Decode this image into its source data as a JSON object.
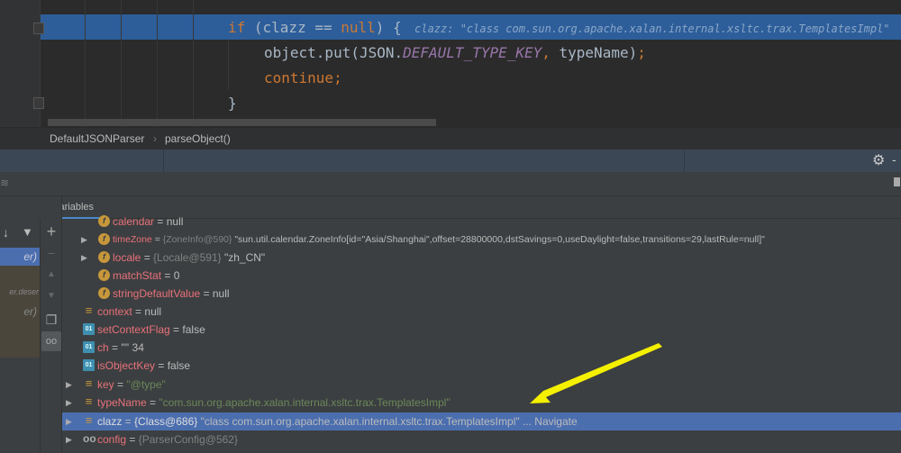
{
  "editor": {
    "line1": {
      "kw_if": "if",
      "open": " (clazz == ",
      "kw_null": "null",
      ") {": ") {",
      "hint": "  clazz: \"class com.sun.org.apache.xalan.internal.xsltc.trax.TemplatesImpl\""
    },
    "line2": {
      "pre": "object.put(JSON.",
      "const": "DEFAULT_TYPE_KEY",
      "comma": ",",
      "post": " typeName)",
      "semi": ";"
    },
    "line3": {
      "kw": "continue",
      "semi": ";"
    },
    "line4": "}"
  },
  "breadcrumb": {
    "items": [
      "DefaultJSONParser",
      "parseObject()"
    ],
    "sep": "›"
  },
  "debugger": {
    "tab": "Variables",
    "frames": {
      "selected": "er)",
      "items": [
        "er.deser",
        "er)"
      ]
    },
    "variables": [
      {
        "name": "calendar",
        "value": "null",
        "icon": "field",
        "level": 2,
        "expandable": false
      },
      {
        "name": "timeZone",
        "type": "{ZoneInfo@590}",
        "value": "\"sun.util.calendar.ZoneInfo[id=\"Asia/Shanghai\",offset=28800000,dstSavings=0,useDaylight=false,transitions=29,lastRule=null]\"",
        "icon": "field",
        "level": 2,
        "expandable": true
      },
      {
        "name": "locale",
        "type": "{Locale@591}",
        "value": "\"zh_CN\"",
        "icon": "field",
        "level": 2,
        "expandable": true
      },
      {
        "name": "matchStat",
        "value": "0",
        "icon": "field",
        "level": 2,
        "expandable": false
      },
      {
        "name": "stringDefaultValue",
        "value": "null",
        "icon": "field",
        "level": 2,
        "expandable": false
      },
      {
        "name": "context",
        "value": "null",
        "icon": "local",
        "level": 1,
        "expandable": false
      },
      {
        "name": "setContextFlag",
        "value": "false",
        "icon": "primitive",
        "level": 1,
        "expandable": false
      },
      {
        "name": "ch",
        "value": "'\"' 34",
        "icon": "primitive",
        "level": 1,
        "expandable": false
      },
      {
        "name": "isObjectKey",
        "value": "false",
        "icon": "primitive",
        "level": 1,
        "expandable": false
      },
      {
        "name": "key",
        "string": "\"@type\"",
        "icon": "local",
        "level": 1,
        "expandable": true
      },
      {
        "name": "typeName",
        "string": "\"com.sun.org.apache.xalan.internal.xsltc.trax.TemplatesImpl\"",
        "icon": "local",
        "level": 1,
        "expandable": true
      },
      {
        "name": "clazz",
        "type": "{Class@686}",
        "value": "\"class com.sun.org.apache.xalan.internal.xsltc.trax.TemplatesImpl\"",
        "link": "... Navigate",
        "icon": "local",
        "level": 1,
        "expandable": true,
        "selected": true
      },
      {
        "name": "config",
        "type": "{ParserConfig@562}",
        "icon": "watch",
        "level": 1,
        "expandable": true
      }
    ]
  },
  "colors": {
    "highlight": "#2d5e9a",
    "selection": "#4b6eaf",
    "annotation_arrow": "#f5f000"
  }
}
